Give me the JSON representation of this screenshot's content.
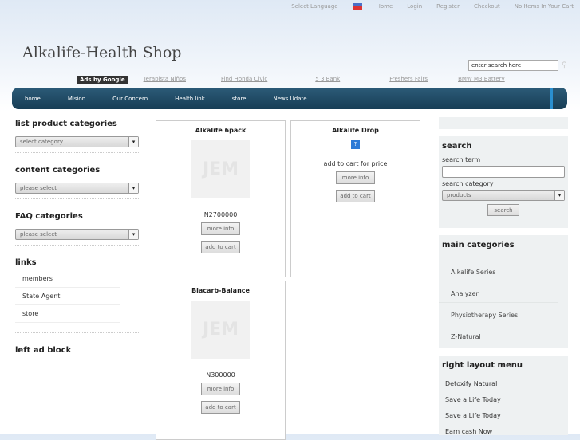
{
  "top": {
    "select_language": "Select Language",
    "links": [
      "Home",
      "Login",
      "Register",
      "Checkout",
      "No Items In Your Cart"
    ]
  },
  "site_title": "Alkalife-Health Shop",
  "top_search": {
    "value": "enter search here"
  },
  "ads": {
    "label": "Ads by Google",
    "links": [
      "Terapista Niños",
      "Find Honda Civic",
      "5 3 Bank",
      "Freshers Fairs",
      "BMW M3 Battery"
    ]
  },
  "nav": [
    "home",
    "Mision",
    "Our Concern",
    "Health link",
    "store",
    "News Udate"
  ],
  "left": {
    "product_categories": {
      "title": "list product categories",
      "value": "select category"
    },
    "content_categories": {
      "title": "content categories",
      "value": "please select"
    },
    "faq_categories": {
      "title": "FAQ categories",
      "value": "please select"
    },
    "links": {
      "title": "links",
      "items": [
        "members",
        "State Agent",
        "store"
      ]
    },
    "ad_block": "left ad block"
  },
  "products": [
    {
      "name": "Alkalife 6pack",
      "price": "N2700000",
      "image": "JEM",
      "more": "more info",
      "cart": "add to cart"
    },
    {
      "name": "Alkalife Drop",
      "price": "add to cart for price",
      "image": "?",
      "more": "more info",
      "cart": "add to cart"
    },
    {
      "name": "Biacarb-Balance",
      "price": "N300000",
      "image": "JEM",
      "more": "more info",
      "cart": "add to cart"
    }
  ],
  "right": {
    "search": {
      "title": "search",
      "term_label": "search term",
      "term_value": "",
      "category_label": "search category",
      "category_value": "products",
      "button": "search"
    },
    "main_categories": {
      "title": "main categories",
      "items": [
        "Alkalife Series",
        "Analyzer",
        "Physiotherapy Series",
        "Z-Natural"
      ]
    },
    "layout_menu": {
      "title": "right layout menu",
      "items": [
        "Detoxify Natural",
        "Save a Life Today",
        "Save a Life Today",
        "Earn cash Now"
      ]
    }
  }
}
